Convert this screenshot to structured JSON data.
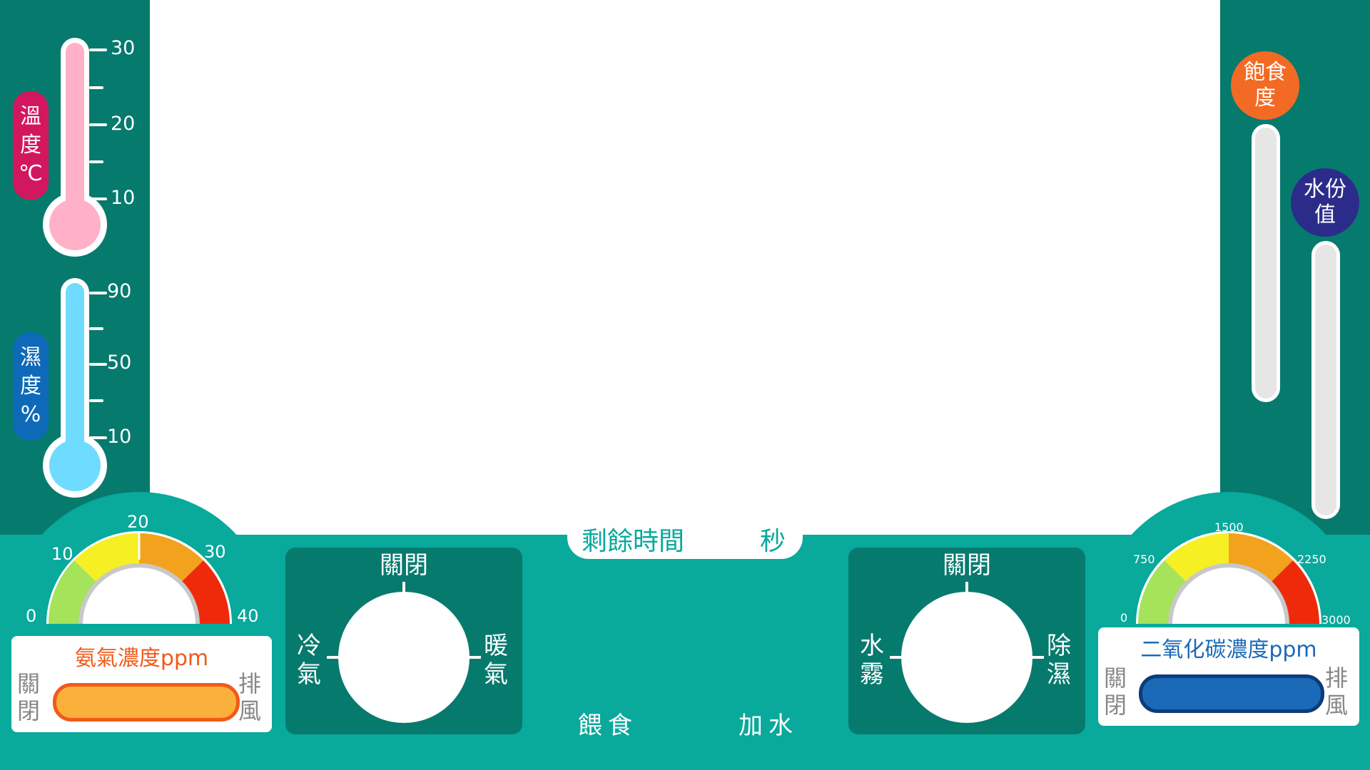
{
  "colors": {
    "teal_main": "#09a99c",
    "teal_dark": "#077a6e",
    "temperature_pink": "#ffb1c8",
    "temperature_label": "#d3175f",
    "humidity_blue": "#6fdcff",
    "humidity_label": "#0e6ab8",
    "satiety_orange": "#f36a24",
    "moisture_navy": "#2b2c8a",
    "ammonia_text": "#f05a1a",
    "co2_text": "#1a6ab8"
  },
  "temperature": {
    "label_lines": [
      "溫",
      "度",
      "℃"
    ],
    "ticks": [
      "30",
      "20",
      "10"
    ]
  },
  "humidity": {
    "label_lines": [
      "濕",
      "度",
      "%"
    ],
    "ticks": [
      "90",
      "50",
      "10"
    ]
  },
  "satiety": {
    "label_lines": [
      "飽食",
      "度"
    ]
  },
  "moisture": {
    "label_lines": [
      "水份",
      "值"
    ]
  },
  "ammonia": {
    "gauge_ticks": [
      "0",
      "10",
      "20",
      "30",
      "40"
    ],
    "title": "氨氣濃度ppm",
    "left_label": [
      "關",
      "閉"
    ],
    "right_label": [
      "排",
      "風"
    ]
  },
  "co2": {
    "gauge_ticks": [
      "0",
      "750",
      "1500",
      "2250",
      "3000"
    ],
    "title": "二氧化碳濃度ppm",
    "left_label": [
      "關",
      "閉"
    ],
    "right_label": [
      "排",
      "風"
    ]
  },
  "timer": {
    "prefix": "剩餘時間",
    "suffix": "秒"
  },
  "climate_knob": {
    "top": "關閉",
    "left": [
      "冷",
      "氣"
    ],
    "right": [
      "暖",
      "氣"
    ]
  },
  "mist_knob": {
    "top": "關閉",
    "left": [
      "水",
      "霧"
    ],
    "right": [
      "除",
      "濕"
    ]
  },
  "actions": {
    "feed": "餵食",
    "water": "加水"
  }
}
